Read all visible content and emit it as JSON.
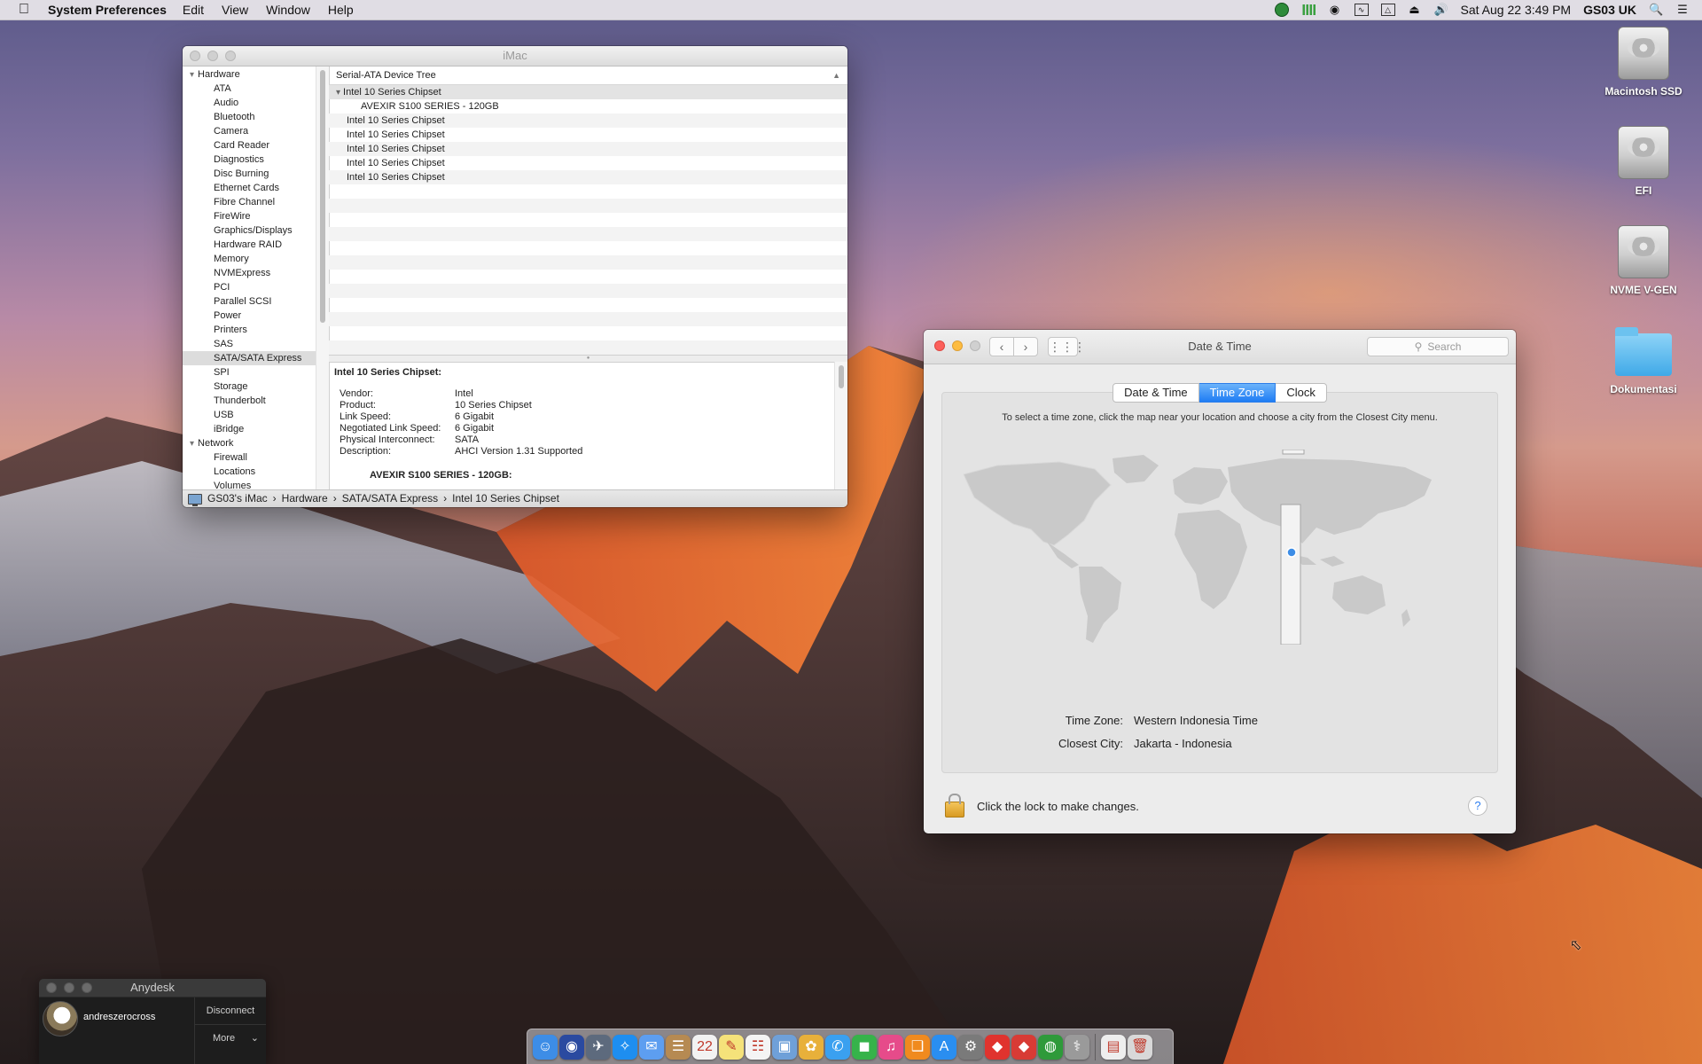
{
  "menubar": {
    "app_name": "System Preferences",
    "menus": [
      "Edit",
      "View",
      "Window",
      "Help"
    ],
    "status_icons": [
      "anydesk-status-icon",
      "signal-bars-icon",
      "nvidia-icon",
      "activity-monitor-icon",
      "airplay-icon",
      "eject-icon",
      "volume-icon"
    ],
    "datetime": "Sat Aug 22  3:49 PM",
    "user": "GS03 UK"
  },
  "desktop_icons": [
    {
      "label": "Macintosh SSD",
      "kind": "hdd"
    },
    {
      "label": "EFI",
      "kind": "hdd"
    },
    {
      "label": "NVME V-GEN",
      "kind": "hdd"
    },
    {
      "label": "Dokumentasi",
      "kind": "folder"
    }
  ],
  "sysinfo": {
    "title": "iMac",
    "sidebar": {
      "hardware_label": "Hardware",
      "hardware_items": [
        "ATA",
        "Audio",
        "Bluetooth",
        "Camera",
        "Card Reader",
        "Diagnostics",
        "Disc Burning",
        "Ethernet Cards",
        "Fibre Channel",
        "FireWire",
        "Graphics/Displays",
        "Hardware RAID",
        "Memory",
        "NVMExpress",
        "PCI",
        "Parallel SCSI",
        "Power",
        "Printers",
        "SAS",
        "SATA/SATA Express",
        "SPI",
        "Storage",
        "Thunderbolt",
        "USB",
        "iBridge"
      ],
      "selected": "SATA/SATA Express",
      "network_label": "Network",
      "network_items": [
        "Firewall",
        "Locations",
        "Volumes"
      ]
    },
    "tree_header": "Serial-ATA Device Tree",
    "tree": {
      "root": "Intel 10 Series Chipset",
      "child": "AVEXIR S100 SERIES - 120GB",
      "rows": [
        "Intel 10 Series Chipset",
        "Intel 10 Series Chipset",
        "Intel 10 Series Chipset",
        "Intel 10 Series Chipset",
        "Intel 10 Series Chipset"
      ]
    },
    "detail": {
      "heading": "Intel 10 Series Chipset:",
      "fields": [
        {
          "k": "Vendor:",
          "v": "Intel"
        },
        {
          "k": "Product:",
          "v": "10 Series Chipset"
        },
        {
          "k": "Link Speed:",
          "v": "6 Gigabit"
        },
        {
          "k": "Negotiated Link Speed:",
          "v": "6 Gigabit"
        },
        {
          "k": "Physical Interconnect:",
          "v": "SATA"
        },
        {
          "k": "Description:",
          "v": "AHCI Version 1.31 Supported"
        }
      ],
      "subheading": "AVEXIR S100 SERIES - 120GB:"
    },
    "path": [
      "GS03's iMac",
      "Hardware",
      "SATA/SATA Express",
      "Intel 10 Series Chipset"
    ]
  },
  "datetime_prefs": {
    "title": "Date & Time",
    "search_placeholder": "Search",
    "tabs": [
      "Date & Time",
      "Time Zone",
      "Clock"
    ],
    "active_tab": "Time Zone",
    "instructions": "To select a time zone, click the map near your location and choose a city from the Closest City menu.",
    "time_zone_label": "Time Zone:",
    "time_zone_value": "Western Indonesia Time",
    "closest_city_label": "Closest City:",
    "closest_city_value": "Jakarta - Indonesia",
    "lock_text": "Click the lock to make changes.",
    "help_label": "?"
  },
  "anydesk": {
    "title": "Anydesk",
    "user": "andreszerocross",
    "disconnect_label": "Disconnect",
    "more_label": "More"
  },
  "dock": {
    "apps": [
      {
        "name": "finder-icon",
        "color": "#3d8de6",
        "glyph": "☺"
      },
      {
        "name": "siri-icon",
        "color": "#2a4aa0",
        "glyph": "◉"
      },
      {
        "name": "launchpad-icon",
        "color": "#5d6a7d",
        "glyph": "✈"
      },
      {
        "name": "safari-icon",
        "color": "#1e8ef0",
        "glyph": "✧"
      },
      {
        "name": "mail-icon",
        "color": "#5d9ef0",
        "glyph": "✉"
      },
      {
        "name": "contacts-icon",
        "color": "#b68a52",
        "glyph": "☰"
      },
      {
        "name": "calendar-icon",
        "color": "#f2f2f2",
        "glyph": "22"
      },
      {
        "name": "notes-icon",
        "color": "#f5e27a",
        "glyph": "✎"
      },
      {
        "name": "reminders-icon",
        "color": "#f4f4f4",
        "glyph": "☷"
      },
      {
        "name": "photos-preview-icon",
        "color": "#6fa0d8",
        "glyph": "▣"
      },
      {
        "name": "photos-icon",
        "color": "#e8b03a",
        "glyph": "✿"
      },
      {
        "name": "messages-icon",
        "color": "#3aa0f0",
        "glyph": "✆"
      },
      {
        "name": "facetime-icon",
        "color": "#36b34a",
        "glyph": "◼"
      },
      {
        "name": "itunes-icon",
        "color": "#e64b8a",
        "glyph": "♫"
      },
      {
        "name": "ibooks-icon",
        "color": "#f08a1e",
        "glyph": "❑"
      },
      {
        "name": "app-store-icon",
        "color": "#2a8ef0",
        "glyph": "A"
      },
      {
        "name": "system-preferences-icon",
        "color": "#7a7a7a",
        "glyph": "⚙"
      },
      {
        "name": "anydesk-icon",
        "color": "#e0332e",
        "glyph": "◆"
      },
      {
        "name": "anydesk-remote-icon",
        "color": "#d83b35",
        "glyph": "◆"
      },
      {
        "name": "globe-app-icon",
        "color": "#2e9a3a",
        "glyph": "◍"
      },
      {
        "name": "disk-utility-icon",
        "color": "#9a9a9a",
        "glyph": "⚕"
      }
    ],
    "trailing": [
      {
        "name": "downloads-stack-icon",
        "color": "#eeeeee",
        "glyph": "▤"
      },
      {
        "name": "trash-icon",
        "color": "#d8d8d8",
        "glyph": "🗑"
      }
    ]
  }
}
